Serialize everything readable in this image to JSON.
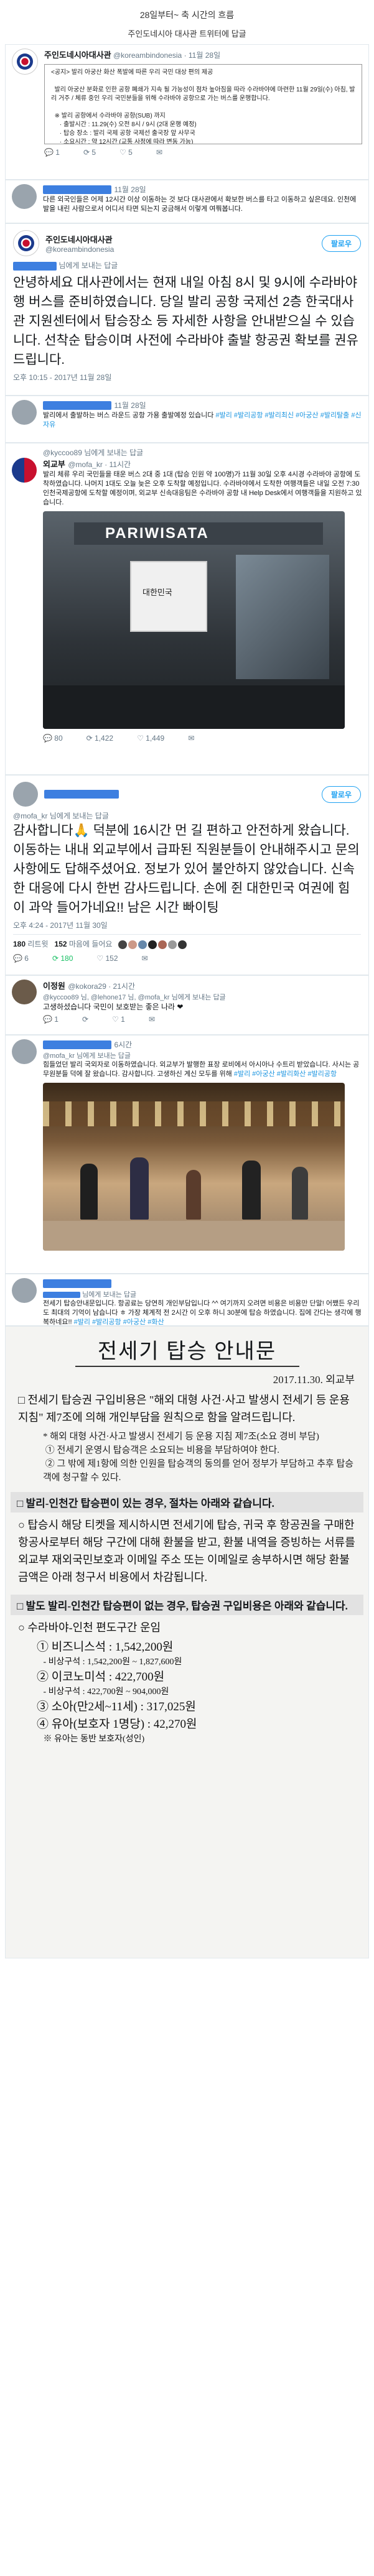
{
  "header": {
    "line1": "28일부터~ 축 시간의 흐름",
    "line2": "주인도네시아 대사관 트위터에 답글"
  },
  "notice": {
    "author": "주인도네시아대사관",
    "handle": "@koreambindonesia · 11월 28일",
    "body": "<공지> 발리 아궁산 화산 폭발에 따른 우리 국민 대상 편의 제공\n\n  발리 아궁산 분화로 인한 공항 폐쇄가 지속 될 가능성이 점차 높아짐을 따라 수라바야에 마련한 11월 29일(수) 아침, 발리 거주 / 체류 중인 우리 국민분들을 위해 수라바야 공항으로 가는 버스를 운행합니다.\n\n  ※ 발리 공항에서 수라바야 공항(SUB) 까지\n     · 출발시간 : 11.29(수) 오전 8시 / 9시 (2대 운행 예정)\n     · 탑승 장소 : 발리 국제 공항 국제선 출국장 앞 사무국\n     · 소요시간 : 약 12시간 (교통 사정에 따라 변동 가능)\n\n  ※ 수라바야 항공 운항 관련 문의는 영사콜센터 및 사무국\n\n  2. 대사관 연락처 : 주인도네시아 대한민국 대사관 +62-21-2967-2580\n     · 대표번호 : +62-21-2967-2555\n     · 당직번호 : +62-811-852-446\n     · 영사 긴급전화 : +62-21-3250-4404",
    "replies": "1",
    "retweets": "5",
    "likes": "5"
  },
  "reply1": {
    "date": "11월 28일",
    "text": "다른 외국인들은 어제 12시간 이상 이동하는 것 보다 대사관에서 확보한 버스를 타고 이동하고 싶은데요. 인천에 발을 내린 사람으로서 어디서 타면 되는지 궁금해서 이렇게 여쭤봅니다."
  },
  "embassy_reply": {
    "author": "주인도네시아대사관",
    "handle": "@koreambindonesia",
    "follow": "팔로우",
    "reply_to": "님에게 보내는 답글",
    "text": "안녕하세요 대사관에서는 현재 내일 아침 8시 및 9시에 수라바야행 버스를 준비하였습니다. 당일 발리 공항 국제선 2층 한국대사관 지원센터에서 탑승장소 등 자세한 사항을 안내받으실 수 있습니다. 선착순 탑승이며 사전에 수라바야 출발 항공권 확보를 권유드립니다.",
    "time": "오후 10:15 - 2017년 11월 28일"
  },
  "reply2": {
    "date": "11월 28일",
    "text": "발리에서 출발하는 버스 라운드 공항 가용 출발예정 있습니다 ",
    "tags": "#발리 #발리공항 #발리최신 #아궁산 #발리탈출 #신자유"
  },
  "mofa": {
    "author": "외교부",
    "handle": "@mofa_kr · 11시간",
    "text": "발리 체류 우리 국민들을 태운 버스 2대 중 1대 (탑승 인원 약 100명)가 11월 30일 오후 4시경 수라바야 공항에 도착하였습니다. 나머지 1대도 오늘 늦은 오후 도착할 예정입니다. 수라바야에서 도착한 여행객들은 내일 오전 7:30 인천국제공항에 도착할 예정이며, 외교부 신속대응팀은 수라바야 공항 내 Help Desk에서 여행객들을 지원하고 있습니다.",
    "bus_word": "PARIWISATA",
    "sign": "대한민국",
    "replies": "80",
    "retweets": "1,422",
    "likes": "1,449"
  },
  "thanks": {
    "follow": "팔로우",
    "reply_to": "님에게 보내는 답글",
    "text": "감사합니다🙏 덕분에 16시간 먼 길 편하고 안전하게 왔습니다. 이동하는 내내 외교부에서 급파된 직원분들이 안내해주시고 문의사항에도 답해주셨어요. 정보가 있어 불안하지 않았습니다. 신속한 대응에 다시 한번 감사드립니다. 손에 쥔 대한민국 여권에 힘이 과악 들어가네요!! 남은 시간 빠이팅",
    "time": "오후 4:24 - 2017년 11월 30일",
    "rt_count": "180",
    "rt_label": "리트윗",
    "like_count": "152",
    "like_label": "마음에 들어요",
    "replies": "6",
    "retweets": "180",
    "likes": "152"
  },
  "leejh": {
    "author": "이정원",
    "handle": "@kokora29 · 21시간",
    "reply_to": "@kyccoo89 님, @lehone17 님, @mofa_kr 님에게 보내는 답글",
    "text": "고생하셨습니다 국민이 보호받는 좋은 나라 ❤",
    "replies": "1",
    "likes": "1"
  },
  "reply3": {
    "date": "6시간",
    "reply_to": "@mofa_kr 님에게 보내는 답글",
    "text": "힘들었던 발리 국외자로 이동하였습니다. 외교부가 발행한 표장 로비에서 아시아나 수트리 받았습니다. 사시는 공무원분들 덕에 잘 왔습니다. 감사합니다. 고생하신 계신 모두를 위해 ",
    "tags": "#발리 #아궁산 #발리화산 #발리공항"
  },
  "reply4": {
    "reply_to": "님에게 보내는 답글",
    "text": "전세기 탑승안내문입니다. 항공료는 당연히 개인부담입니다 ^^ 여기까지 오려면 비용은 비용만 단말! 어쨌든 우리도 최대의 기억이 남습니다 ㅎ 가장 체계적 전 2시간 이 오후 하니 30분에 탑승 하였습니다. 집에 간다는 생각에 행복하네요!! ",
    "tags": "#발리 #발리공항 #아궁산 #화산"
  },
  "document": {
    "title": "전세기 탑승 안내문",
    "date": "2017.11.30. 외교부",
    "bullet1": "□ 전세기 탑승권 구입비용은 \"해외 대형 사건·사고 발생시 전세기 등 운용 지침\" 제7조에 의해 개인부담을 원칙으로 함을 알려드립니다.",
    "sub1": "* 해외 대형 사건·사고 발생시 전세기 등 운용 지침 제7조(소요 경비 부담)\n ① 전세기 운영시 탑승객은 소요되는 비용을 부담하여야 한다.\n ② 그 밖에 제1항에 의한 인원을 탑승객의 동의를 얻어 정부가 부담하고 추후 탑승객에 청구할 수 있다.",
    "sec1": "□ 발리-인천간 탑승편이 있는 경우, 절차는 아래와 같습니다.",
    "p2": " ○ 탑승시 해당 티켓을 제시하시면 전세기에 탑승, 귀국 후 항공권을 구매한 항공사로부터 해당 구간에 대해 환불을 받고, 환불 내역을 증빙하는 서류를 외교부 재외국민보호과 이메일 주소 또는 이메일로 송부하시면 해당 환불 금액은 아래 청구서 비용에서 차감됩니다.",
    "sec2": "□ 발도 발리-인천간 탑승편이 없는 경우, 탑승권 구입비용은 아래와 같습니다.",
    "p3": " ○ 수라바야-인천 편도구간 운임",
    "items": [
      "① 비즈니스석 : 1,542,200원",
      "   - 비상구석 : 1,542,200원 ~ 1,827,600원",
      "② 이코노미석 : 422,700원",
      "   - 비상구석 : 422,700원 ~ 904,000원",
      "③ 소아(만2세~11세) : 317,025원",
      "④ 유아(보호자 1명당) : 42,270원",
      "   ※ 유아는 동반 보호자(성인)"
    ]
  }
}
